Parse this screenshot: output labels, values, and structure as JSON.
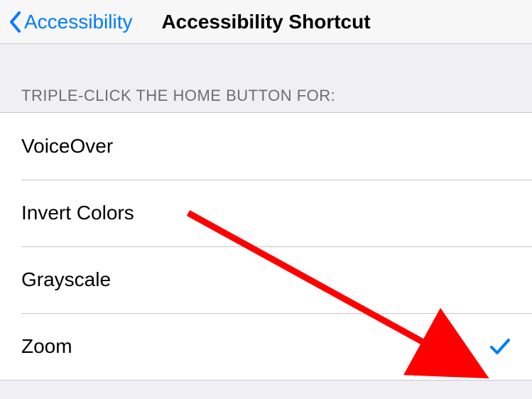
{
  "nav": {
    "back_label": "Accessibility",
    "title": "Accessibility Shortcut"
  },
  "section_header": "Triple-click the home button for:",
  "options": [
    {
      "label": "VoiceOver",
      "selected": false
    },
    {
      "label": "Invert Colors",
      "selected": false
    },
    {
      "label": "Grayscale",
      "selected": false
    },
    {
      "label": "Zoom",
      "selected": true
    }
  ],
  "colors": {
    "accent": "#007aff",
    "annotation": "#ff0000"
  }
}
